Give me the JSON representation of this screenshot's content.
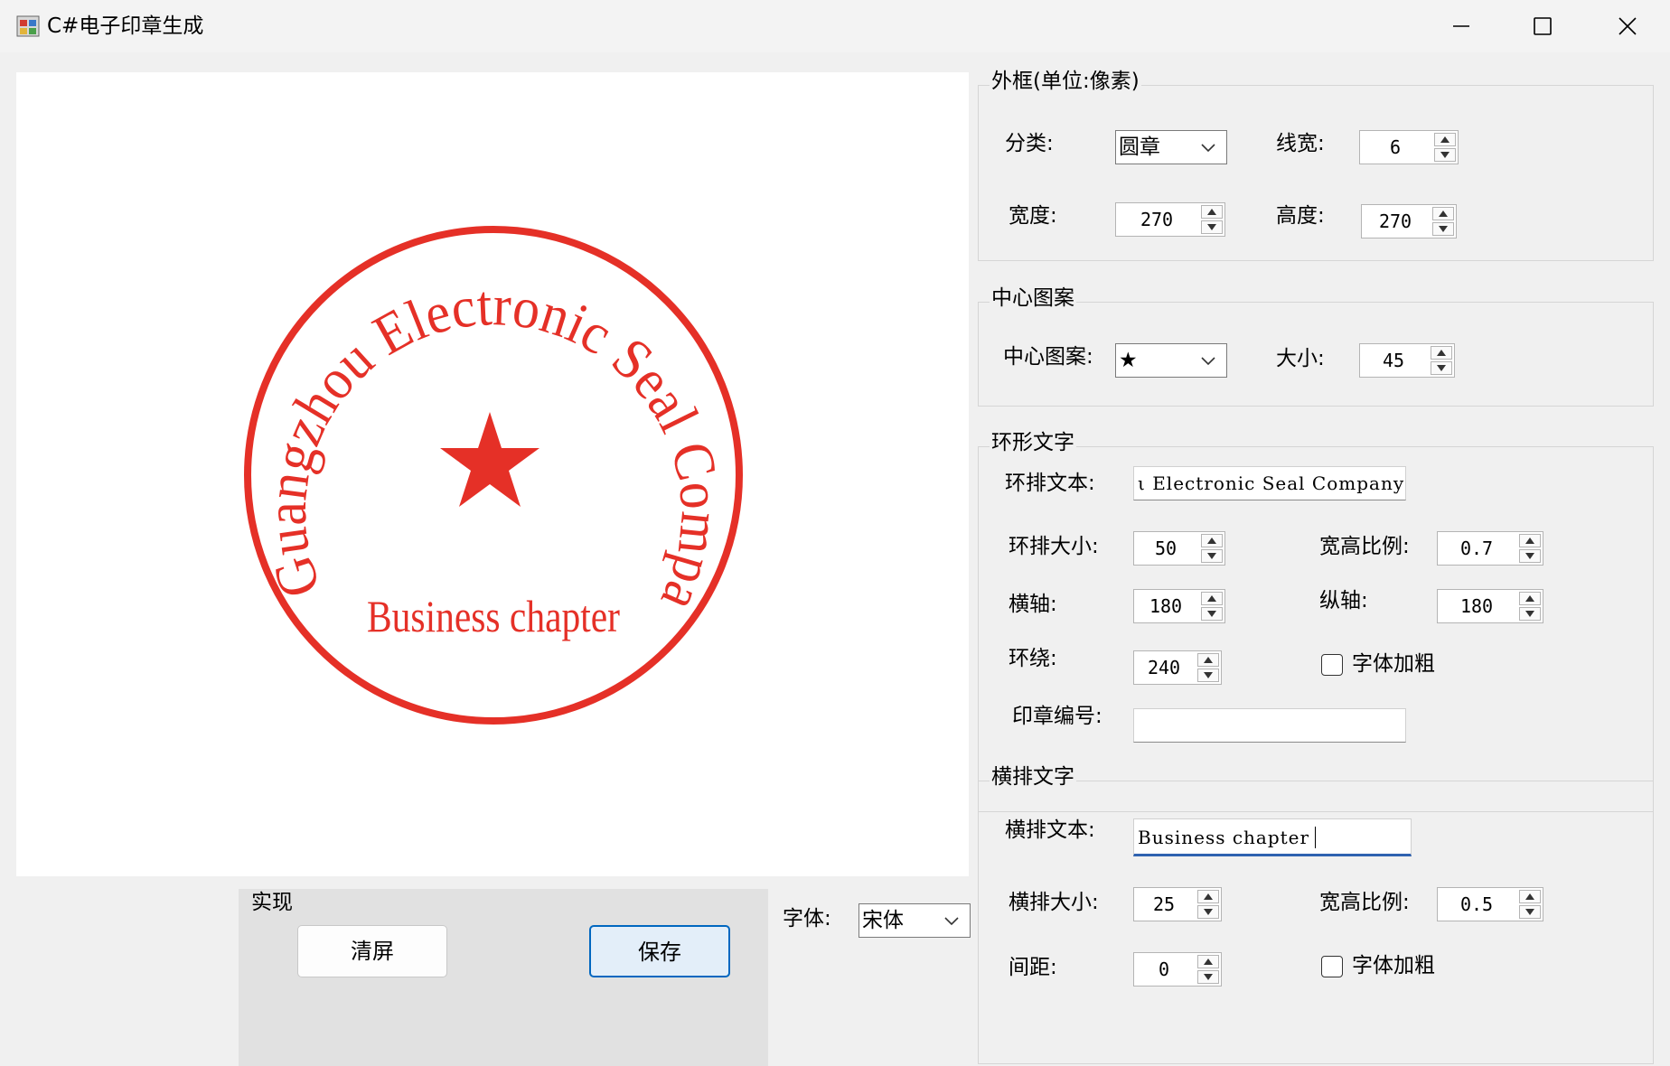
{
  "window": {
    "title": "C#电子印章生成",
    "icon": "app-icon",
    "controls": [
      "minimize-icon",
      "maximize-icon",
      "close-icon"
    ]
  },
  "seal": {
    "color": "#e53027",
    "ring_text": "Guangzhou Electronic Seal Company",
    "horizontal_text": "Business chapter",
    "center_symbol": "★"
  },
  "outer_frame": {
    "legend": "外框(单位:像素)",
    "type_label": "分类:",
    "type_value": "圆章",
    "line_width_label": "线宽:",
    "line_width_value": "6",
    "width_label": "宽度:",
    "width_value": "270",
    "height_label": "高度:",
    "height_value": "270"
  },
  "center_pattern": {
    "legend": "中心图案",
    "pattern_label": "中心图案:",
    "pattern_value": "★",
    "size_label": "大小:",
    "size_value": "45"
  },
  "ring_text": {
    "legend": "环形文字",
    "text_label": "环排文本:",
    "text_value": "ι Electronic Seal Company",
    "size_label": "环排大小:",
    "size_value": "50",
    "ratio_label": "宽高比例:",
    "ratio_value": "0.7",
    "x_label": "横轴:",
    "x_value": "180",
    "y_label": "纵轴:",
    "y_value": "180",
    "wrap_label": "环绕:",
    "wrap_value": "240",
    "bold_label": "字体加粗",
    "bold_checked": false,
    "number_label": "印章编号:",
    "number_value": ""
  },
  "horizontal_text": {
    "legend": "横排文字",
    "text_label": "横排文本:",
    "text_value": "Business chapter",
    "size_label": "横排大小:",
    "size_value": "25",
    "ratio_label": "宽高比例:",
    "ratio_value": "0.5",
    "spacing_label": "间距:",
    "spacing_value": "0",
    "bold_label": "字体加粗",
    "bold_checked": false
  },
  "actions": {
    "legend": "实现",
    "clear_label": "清屏",
    "save_label": "保存"
  },
  "font": {
    "label": "字体:",
    "value": "宋体"
  }
}
